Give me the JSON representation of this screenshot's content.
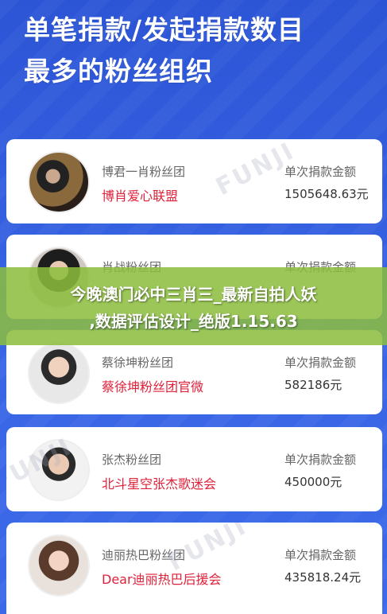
{
  "headline": {
    "line1": "单笔捐款/发起捐款数目",
    "line2": "最多的粉丝组织"
  },
  "column_labels": {
    "amount_label": "单次捐款金额"
  },
  "cards": [
    {
      "group": "博君一肖粉丝团",
      "org": "博肖爱心联盟",
      "amount": "1505648.63元"
    },
    {
      "group": "肖战粉丝团",
      "org": "",
      "amount": ""
    },
    {
      "group": "蔡徐坤粉丝团",
      "org": "蔡徐坤粉丝团官微",
      "amount": "582186元"
    },
    {
      "group": "张杰粉丝团",
      "org": "北斗星空张杰歌迷会",
      "amount": "450000元"
    },
    {
      "group": "迪丽热巴粉丝团",
      "org": "Dear迪丽热巴后援会",
      "amount": "435818.24元"
    }
  ],
  "watermark": "FUNJI",
  "overlay": {
    "line1": "今晚澳门必中三肖三_最新自拍人妖",
    "line2": ",数据评估设计_绝版1.15.63"
  },
  "colors": {
    "background": "#2f58d8",
    "org_name": "#e0213a",
    "overlay": "#8cbe3c"
  }
}
